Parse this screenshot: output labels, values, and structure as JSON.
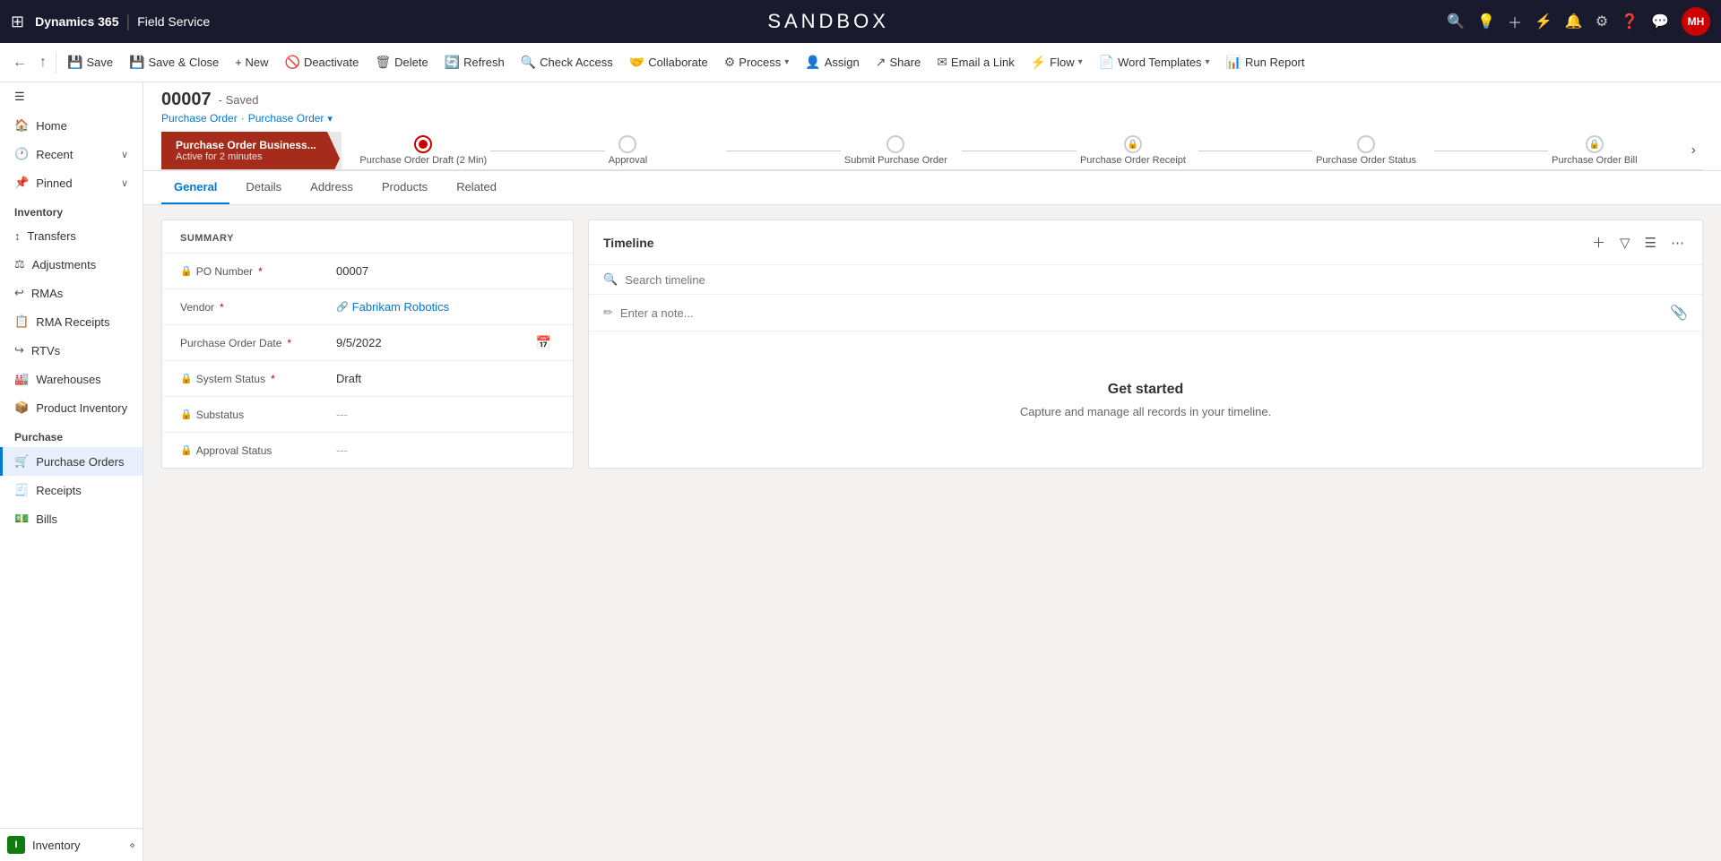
{
  "topNav": {
    "appGrid": "⊞",
    "brandDynamics": "Dynamics 365",
    "brandSep": "|",
    "brandModule": "Field Service",
    "sandboxTitle": "SANDBOX",
    "avatar": "MH"
  },
  "commandBar": {
    "back": "←",
    "forward": "⤴",
    "save": "Save",
    "saveClose": "Save & Close",
    "new": "+ New",
    "deactivate": "Deactivate",
    "delete": "Delete",
    "refresh": "Refresh",
    "checkAccess": "Check Access",
    "collaborate": "Collaborate",
    "process": "Process",
    "assign": "Assign",
    "share": "Share",
    "emailLink": "Email a Link",
    "flow": "Flow",
    "wordTemplates": "Word Templates",
    "runReport": "Run Report"
  },
  "sidebar": {
    "home": "Home",
    "recent": "Recent",
    "pinned": "Pinned",
    "inventorySection": "Inventory",
    "transfers": "Transfers",
    "adjustments": "Adjustments",
    "rmas": "RMAs",
    "rmaReceipts": "RMA Receipts",
    "rtvs": "RTVs",
    "warehouses": "Warehouses",
    "productInventory": "Product Inventory",
    "purchaseSection": "Purchase",
    "purchaseOrders": "Purchase Orders",
    "receipts": "Receipts",
    "bills": "Bills",
    "bottomLabel": "Inventory",
    "bottomIcon": "I"
  },
  "record": {
    "id": "00007",
    "savedStatus": "- Saved",
    "breadcrumb1": "Purchase Order",
    "breadcrumbSep": "·",
    "breadcrumb2": "Purchase Order",
    "breadcrumbChevron": "▾"
  },
  "processBar": {
    "activeStepTitle": "Purchase Order Business...",
    "activeStepSub": "Active for 2 minutes",
    "step1Label": "Purchase Order Draft  (2 Min)",
    "step2Label": "Approval",
    "step3Label": "Submit Purchase Order",
    "step4Label": "Purchase Order Receipt",
    "step5Label": "Purchase Order Status",
    "step6Label": "Purchase Order Bill"
  },
  "tabs": [
    {
      "label": "General",
      "active": true
    },
    {
      "label": "Details",
      "active": false
    },
    {
      "label": "Address",
      "active": false
    },
    {
      "label": "Products",
      "active": false
    },
    {
      "label": "Related",
      "active": false
    }
  ],
  "summary": {
    "title": "SUMMARY",
    "poNumberLabel": "PO Number",
    "poNumberValue": "00007",
    "vendorLabel": "Vendor",
    "vendorValue": "Fabrikam Robotics",
    "poDateLabel": "Purchase Order Date",
    "poDateValue": "9/5/2022",
    "systemStatusLabel": "System Status",
    "systemStatusValue": "Draft",
    "substatusLabel": "Substatus",
    "substatusValue": "---",
    "approvalStatusLabel": "Approval Status",
    "approvalStatusValue": "---"
  },
  "timeline": {
    "title": "Timeline",
    "searchPlaceholder": "Search timeline",
    "notePlaceholder": "Enter a note...",
    "getStartedTitle": "Get started",
    "getStartedSub": "Capture and manage all records in your timeline."
  }
}
